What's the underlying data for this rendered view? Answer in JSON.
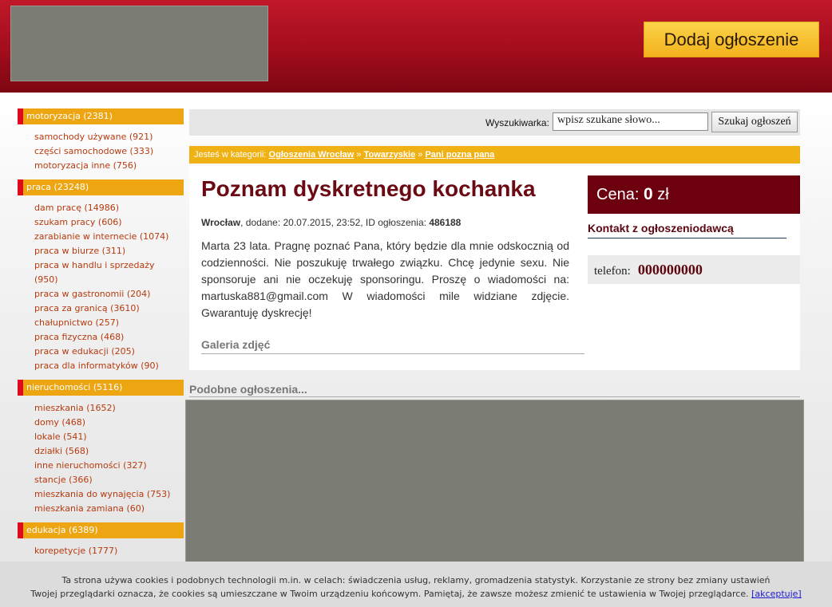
{
  "header": {
    "add_button": "Dodaj ogłoszenie"
  },
  "sidebar": {
    "categories": [
      {
        "title": "motoryzacja (2381)",
        "items": [
          "samochody używane (921)",
          "części samochodowe (333)",
          "motoryzacja inne (756)"
        ]
      },
      {
        "title": "praca (23248)",
        "items": [
          "dam pracę (14986)",
          "szukam pracy (606)",
          "zarabianie w internecie (1074)",
          "praca w biurze (311)",
          "praca w handlu i sprzedaży (950)",
          "praca w gastronomii (204)",
          "praca za granicą (3610)",
          "chałupnictwo (257)",
          "praca fizyczna (468)",
          "praca w edukacji (205)",
          "praca dla informatyków (90)"
        ]
      },
      {
        "title": "nieruchomości (5116)",
        "items": [
          "mieszkania (1652)",
          "domy (468)",
          "lokale (541)",
          "działki (568)",
          "inne nieruchomości (327)",
          "stancje (366)",
          "mieszkania do wynajęcia (753)",
          "mieszkania zamiana (60)"
        ]
      },
      {
        "title": "edukacja (6389)",
        "items": [
          "korepetycje (1777)"
        ]
      }
    ]
  },
  "search": {
    "label": "Wyszukiwarka:",
    "value": "wpisz szukane słowo...",
    "button": "Szukaj ogłoszeń"
  },
  "breadcrumb": {
    "prefix": "Jesteś w kategorii:",
    "links": [
      "Ogłoszenia Wrocław",
      "Towarzyskie",
      "Pani pozna pana"
    ],
    "separator": "»"
  },
  "ad": {
    "title": "Poznam dyskretnego kochanka",
    "city": "Wrocław",
    "meta_text": ", dodane: 20.07.2015, 23:52, ID ogłoszenia: ",
    "id": "486188",
    "description": "Marta 23 lata. Pragnę poznać Pana, który będzie dla mnie odskocznią od codzienności. Nie poszukuję trwałego związku. Chcę jedynie sexu. Nie sponsoruje ani nie oczekuję sponsoringu. Proszę o wiadomości na: martuska881@gmail.com W wiadomości mile widziane zdjęcie. Gwarantuję dyskrecję!",
    "gallery_title": "Galeria zdjęć"
  },
  "price": {
    "label": "Cena:",
    "value": "0",
    "currency": "zł"
  },
  "contact": {
    "title": "Kontakt z ogłoszeniodawcą",
    "phone_label": "telefon:",
    "phone_value": "000000000"
  },
  "similar": {
    "title": "Podobne ogłoszenia..."
  },
  "cookie": {
    "line1": "Ta strona używa cookies i podobnych technologii m.in. w celach: świadczenia usług, reklamy, gromadzenia statystyk. Korzystanie ze strony bez zmiany ustawień",
    "line2": "Twojej przeglądarki oznacza, że cookies są umieszczane w Twoim urządzeniu końcowym. Pamiętaj, że zawsze możesz zmienić te ustawienia w Twojej przeglądarce.",
    "accept": "[akceptuje]"
  },
  "colors": {
    "header_red": "#a30d1c",
    "accent_orange": "#eda511",
    "title_maroon": "#6b0a12",
    "price_bg": "#6c000f"
  }
}
